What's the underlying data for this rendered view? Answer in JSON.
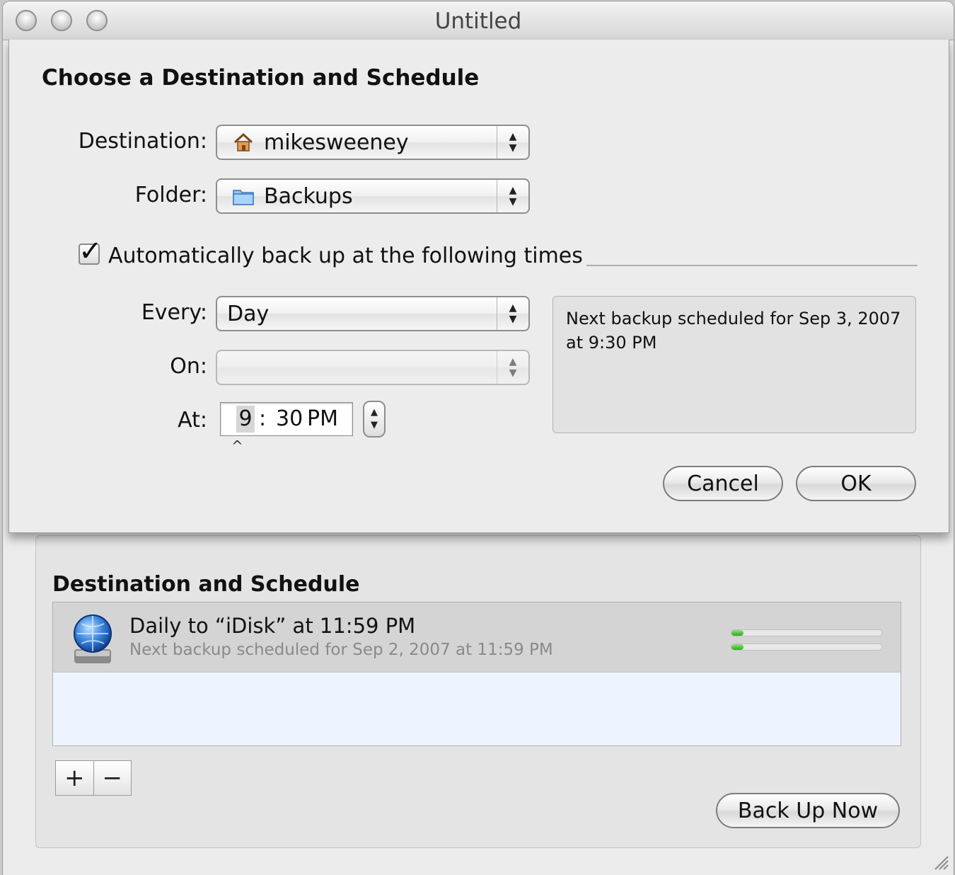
{
  "window": {
    "title": "Untitled"
  },
  "sheet": {
    "title": "Choose a Destination and Schedule",
    "destination": {
      "label": "Destination:",
      "value": "mikesweeney",
      "icon": "home-icon"
    },
    "folder": {
      "label": "Folder:",
      "value": "Backups",
      "icon": "folder-icon"
    },
    "auto_backup": {
      "label": "Automatically back up at the following times",
      "checked": true
    },
    "every": {
      "label": "Every:",
      "value": "Day"
    },
    "on": {
      "label": "On:",
      "value": ""
    },
    "at": {
      "label": "At:",
      "hour": "9",
      "separator": ":",
      "minute": "30",
      "ampm": "PM"
    },
    "next_backup_text": "Next backup scheduled for Sep 3, 2007 at 9:30 PM",
    "cancel_label": "Cancel",
    "ok_label": "OK"
  },
  "main": {
    "section_title": "Destination and Schedule",
    "schedules": [
      {
        "title": "Daily to “iDisk” at 11:59 PM",
        "subtitle": "Next backup scheduled for Sep 2, 2007 at 11:59 PM",
        "icon": "idisk-icon",
        "progress_fraction": 0.08
      }
    ],
    "add_label": "+",
    "remove_label": "−",
    "backup_now_label": "Back Up Now"
  },
  "colors": {
    "progress_green": "#2fa81d",
    "list_background": "#eef4ff",
    "selected_row": "#d4d4d4"
  }
}
